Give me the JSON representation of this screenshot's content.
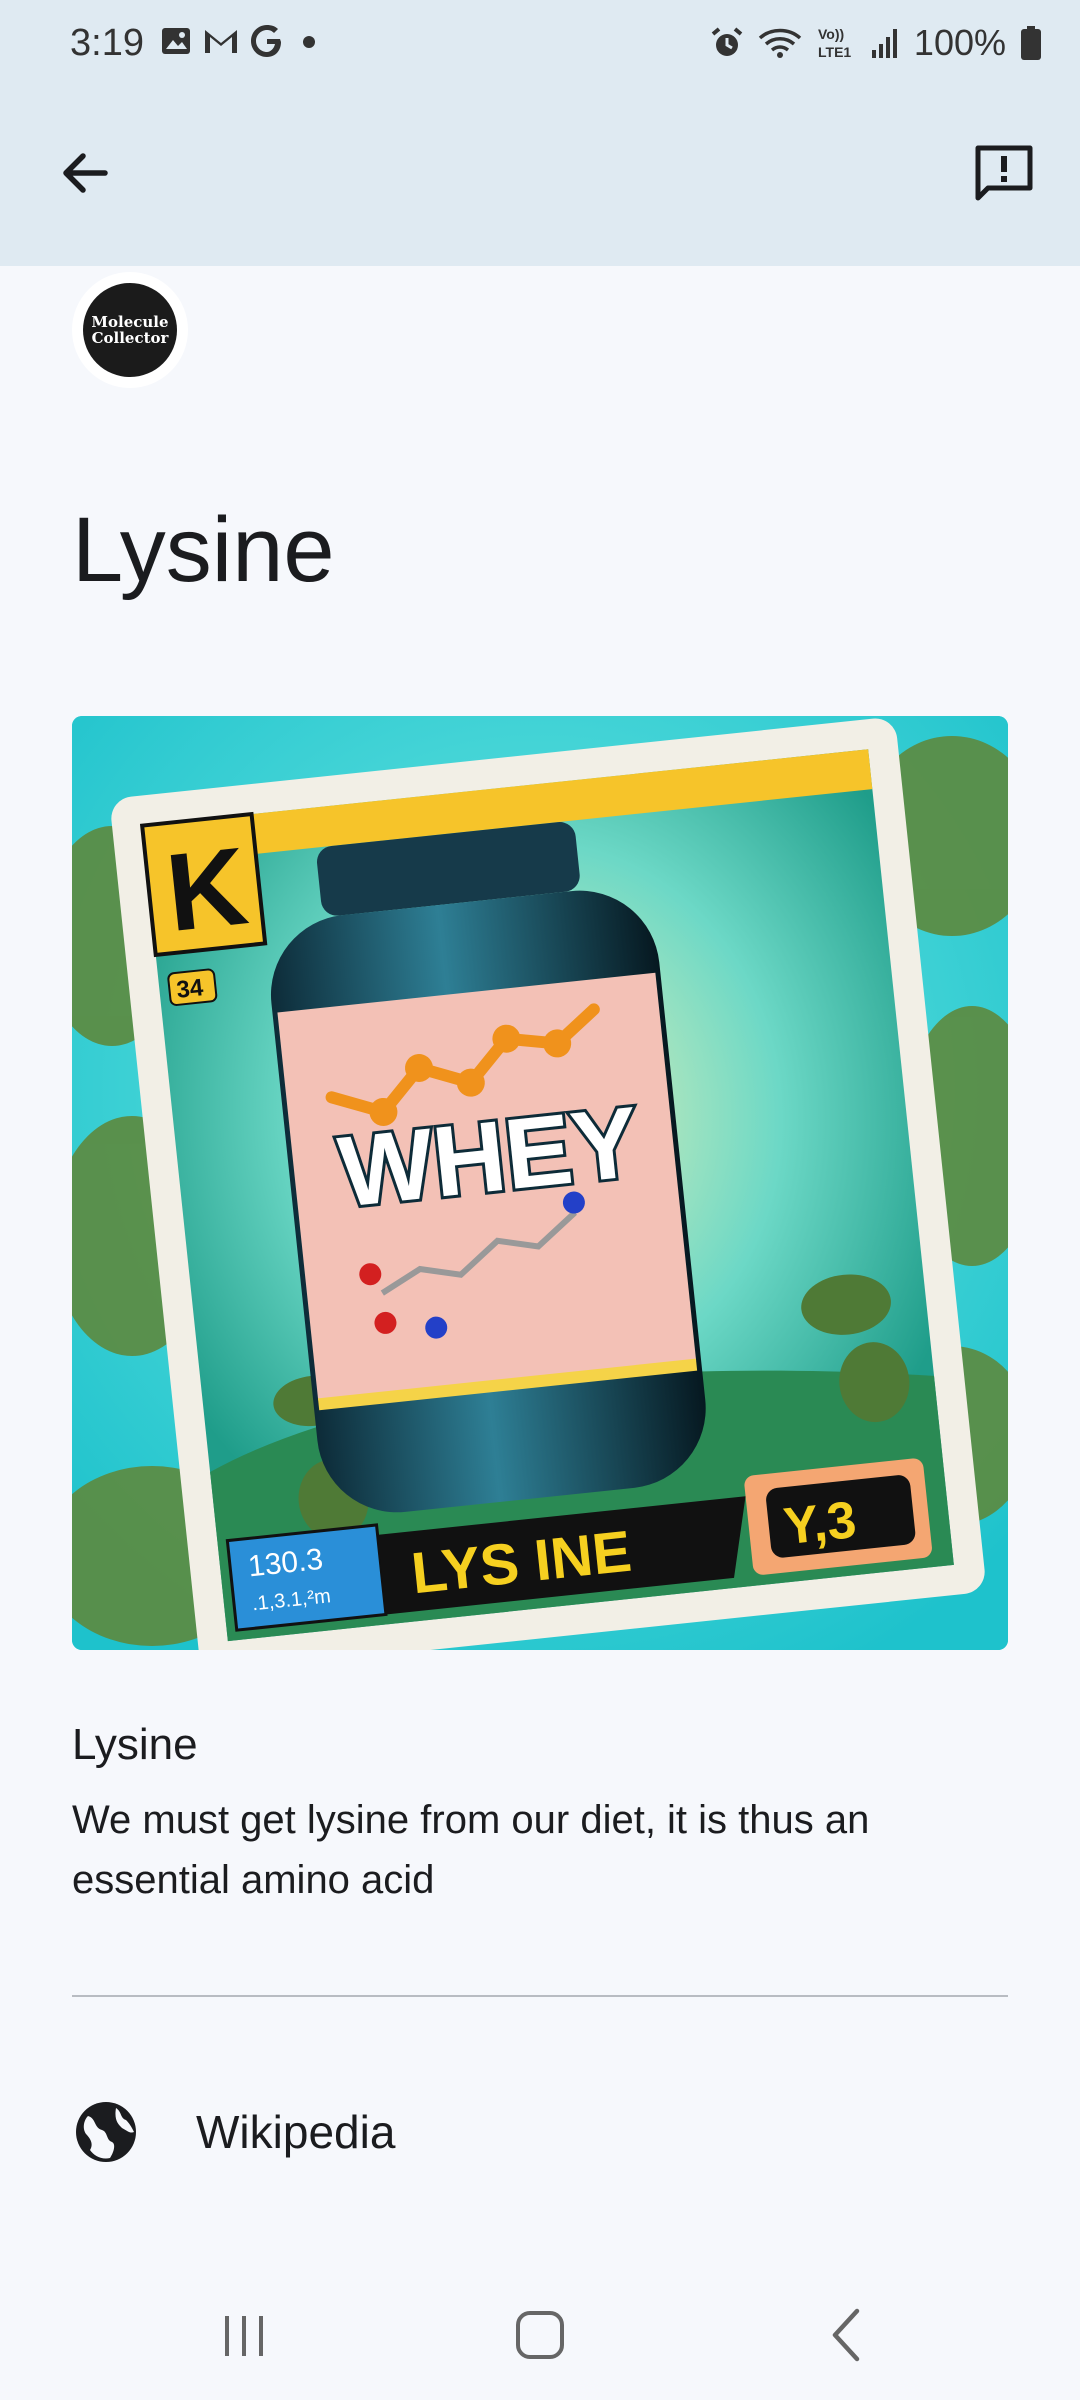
{
  "status": {
    "time": "3:19",
    "battery": "100%",
    "notif_icons": [
      "gallery-icon",
      "gmail-icon",
      "google-icon",
      "dot-icon"
    ],
    "sys_icons": [
      "alarm-icon",
      "wifi-icon",
      "volte-icon",
      "signal-icon",
      "battery-icon"
    ],
    "volte_text": "Vo))\nLTE1"
  },
  "app_bar": {
    "back_icon": "arrow-back-icon",
    "feedback_icon": "feedback-icon"
  },
  "logo": {
    "text_line1": "Molecule",
    "text_line2": "Collector"
  },
  "page": {
    "title": "Lysine"
  },
  "hero_image": {
    "corner_letter": "K",
    "badge_number": "34",
    "jar_label": "WHEY",
    "card_name": "LYS INE",
    "card_code": "Y,3",
    "card_value": "130.3",
    "card_sub": ".1,3.1,²m"
  },
  "info_card": {
    "title": "Lysine",
    "description": "We must get lysine from our diet, it is thus an essential amino acid"
  },
  "links": [
    {
      "label": "Wikipedia",
      "icon": "globe-icon"
    }
  ],
  "nav": {
    "icons": [
      "recents-icon",
      "home-icon",
      "back-nav-icon"
    ]
  },
  "colors": {
    "app_bar": "#dfeaf2",
    "background": "#f6f8fc",
    "text": "#1b1c1f"
  }
}
